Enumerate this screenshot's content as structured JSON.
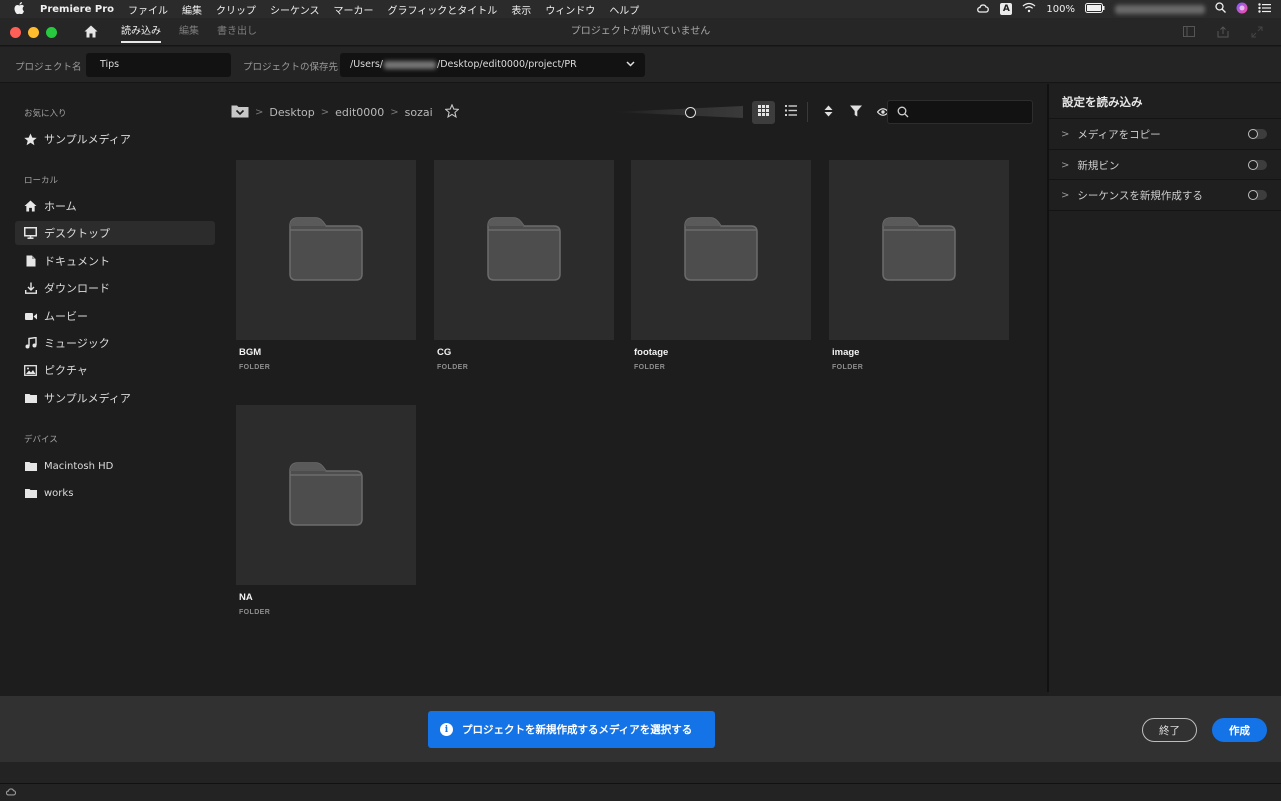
{
  "menubar": {
    "app_name": "Premiere Pro",
    "items": [
      "ファイル",
      "編集",
      "クリップ",
      "シーケンス",
      "マーカー",
      "グラフィックとタイトル",
      "表示",
      "ウィンドウ",
      "ヘルプ"
    ],
    "input_indicator": "A",
    "battery": "100%"
  },
  "titlebar": {
    "tabs": [
      "読み込み",
      "編集",
      "書き出し"
    ],
    "window_title": "プロジェクトが開いていません"
  },
  "project": {
    "name_label": "プロジェクト名",
    "name_value": "Tips",
    "location_label": "プロジェクトの保存先",
    "path_prefix": "/Users/",
    "path_suffix": "/Desktop/edit0000/project/PR"
  },
  "sidebar": {
    "favorites_header": "お気に入り",
    "favorites": [
      {
        "label": "サンプルメディア",
        "icon": "star-icon"
      }
    ],
    "local_header": "ローカル",
    "local": [
      {
        "label": "ホーム",
        "icon": "home-icon"
      },
      {
        "label": "デスクトップ",
        "icon": "monitor-icon"
      },
      {
        "label": "ドキュメント",
        "icon": "document-icon"
      },
      {
        "label": "ダウンロード",
        "icon": "download-icon"
      },
      {
        "label": "ムービー",
        "icon": "video-camera-icon"
      },
      {
        "label": "ミュージック",
        "icon": "music-note-icon"
      },
      {
        "label": "ピクチャ",
        "icon": "picture-icon"
      },
      {
        "label": "サンプルメディア",
        "icon": "folder-icon"
      }
    ],
    "devices_header": "デバイス",
    "devices": [
      {
        "label": "Macintosh HD",
        "icon": "folder-icon"
      },
      {
        "label": "works",
        "icon": "folder-icon"
      }
    ],
    "selected": "デスクトップ"
  },
  "browser": {
    "breadcrumb": [
      "Desktop",
      "edit0000",
      "sozai"
    ],
    "search_placeholder": "",
    "items": [
      {
        "name": "BGM",
        "type": "FOLDER"
      },
      {
        "name": "CG",
        "type": "FOLDER"
      },
      {
        "name": "footage",
        "type": "FOLDER"
      },
      {
        "name": "image",
        "type": "FOLDER"
      },
      {
        "name": "NA",
        "type": "FOLDER"
      }
    ]
  },
  "import_settings": {
    "title": "設定を読み込み",
    "options": [
      {
        "label": "メディアをコピー",
        "enabled": false
      },
      {
        "label": "新規ビン",
        "enabled": false
      },
      {
        "label": "シーケンスを新規作成する",
        "enabled": false
      }
    ]
  },
  "footer": {
    "banner_text": "プロジェクトを新規作成するメディアを選択する",
    "quit_label": "終了",
    "create_label": "作成"
  },
  "colors": {
    "accent": "#1473e6",
    "traffic_red": "#fe5f57",
    "traffic_yellow": "#febc2e",
    "traffic_green": "#28c840"
  }
}
